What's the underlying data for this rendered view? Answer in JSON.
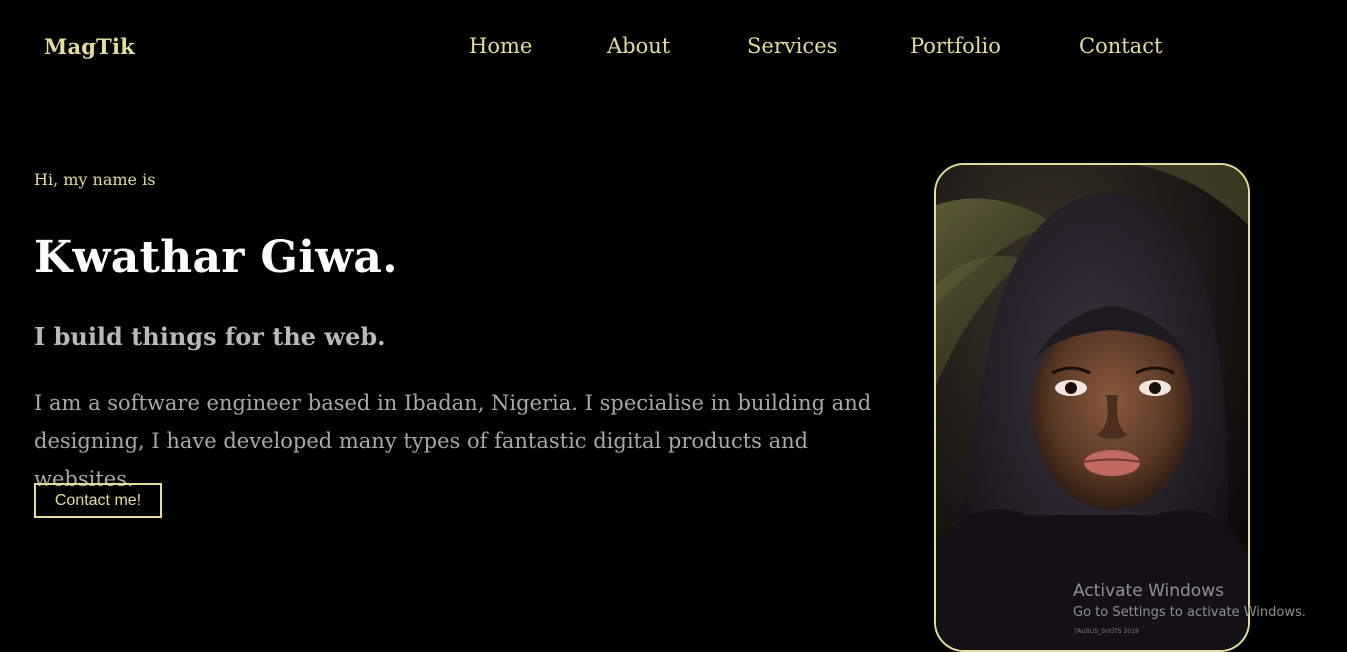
{
  "header": {
    "logo": "MagTik",
    "nav": [
      "Home",
      "About",
      "Services",
      "Portfolio",
      "Contact"
    ]
  },
  "hero": {
    "greeting": "Hi, my name is",
    "name": "Kwathar Giwa.",
    "tagline": "I build things for the web.",
    "intro": "I am a software engineer based in Ibadan, Nigeria. I specialise in building and designing, I have developed many types of fantastic digital products and websites.",
    "cta_label": "Contact me!",
    "photo_caption": "TAURUS_SHOTS 2019"
  },
  "system_overlay": {
    "title": "Activate Windows",
    "subtitle": "Go to Settings to activate Windows."
  },
  "colors": {
    "background": "#000000",
    "accent": "#e3dc9b",
    "heading": "#ffffff",
    "muted": "#a8a8a8"
  }
}
